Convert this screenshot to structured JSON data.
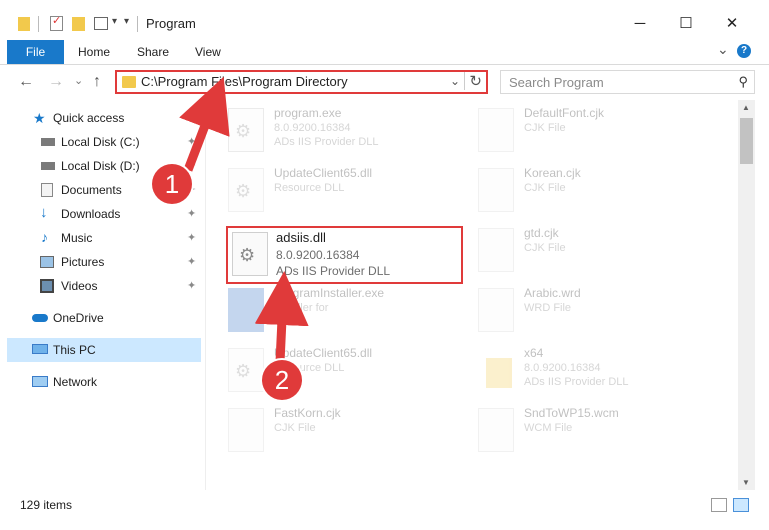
{
  "window": {
    "title": "Program",
    "minimize": "─",
    "maximize": "☐",
    "close": "✕"
  },
  "ribbon": {
    "tabs": [
      {
        "label": "File"
      },
      {
        "label": "Home"
      },
      {
        "label": "Share"
      },
      {
        "label": "View"
      }
    ],
    "expand": "⌄",
    "help": "?"
  },
  "nav": {
    "back": "←",
    "forward": "→",
    "recent": "⌄",
    "up": "↑",
    "address": "C:\\Program Files\\Program Directory",
    "address_dropdown": "⌄",
    "refresh": "↻",
    "search_placeholder": "Search Program",
    "search_icon": "⚲"
  },
  "sidebar": {
    "items": [
      {
        "label": "Quick access",
        "icon": "star-icon"
      },
      {
        "label": "Local Disk (C:)",
        "icon": "drive-icon"
      },
      {
        "label": "Local Disk (D:)",
        "icon": "drive-icon"
      },
      {
        "label": "Documents",
        "icon": "documents-icon"
      },
      {
        "label": "Downloads",
        "icon": "download-icon"
      },
      {
        "label": "Music",
        "icon": "music-icon"
      },
      {
        "label": "Pictures",
        "icon": "pictures-icon"
      },
      {
        "label": "Videos",
        "icon": "videos-icon"
      },
      {
        "label": "OneDrive",
        "icon": "cloud-icon"
      },
      {
        "label": "This PC",
        "icon": "computer-icon"
      },
      {
        "label": "Network",
        "icon": "network-icon"
      }
    ],
    "pin_glyph": "📌"
  },
  "files": [
    {
      "name": "program.exe",
      "meta": "8.0.9200.16384",
      "desc": "ADs IIS Provider DLL",
      "kind": "exe"
    },
    {
      "name": "DefaultFont.cjk",
      "meta": "CJK File",
      "desc": "",
      "kind": "doc"
    },
    {
      "name": "UpdateClient65.dll",
      "meta": "Resource DLL",
      "desc": "",
      "kind": "dll"
    },
    {
      "name": "Korean.cjk",
      "meta": "CJK File",
      "desc": "",
      "kind": "doc"
    },
    {
      "name": "adsiis.dll",
      "meta": "8.0.9200.16384",
      "desc": "ADs IIS Provider DLL",
      "kind": "dll"
    },
    {
      "name": "gtd.cjk",
      "meta": "CJK File",
      "desc": "",
      "kind": "doc"
    },
    {
      "name": "ProgramInstaller.exe",
      "meta": "Installer for",
      "desc": "",
      "kind": "exe"
    },
    {
      "name": "Arabic.wrd",
      "meta": "WRD File",
      "desc": "",
      "kind": "doc"
    },
    {
      "name": "UpdateClient65.dll",
      "meta": "Resource DLL",
      "desc": "",
      "kind": "dll"
    },
    {
      "name": "x64",
      "meta": "8.0.9200.16384",
      "desc": "ADs IIS Provider DLL",
      "kind": "folder"
    },
    {
      "name": "FastKorn.cjk",
      "meta": "CJK File",
      "desc": "",
      "kind": "doc"
    },
    {
      "name": "SndToWP15.wcm",
      "meta": "WCM File",
      "desc": "",
      "kind": "doc"
    }
  ],
  "status": {
    "count": "129 items"
  },
  "callouts": [
    {
      "label": "1"
    },
    {
      "label": "2"
    }
  ],
  "colors": {
    "accent": "#1979ca",
    "highlight": "#e03a3a",
    "selection": "#cce8ff"
  }
}
